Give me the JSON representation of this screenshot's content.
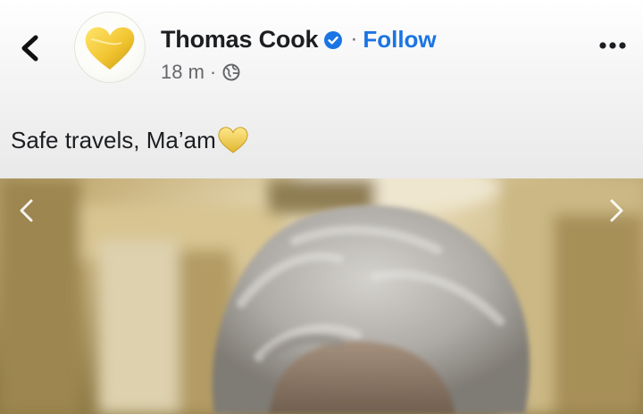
{
  "post": {
    "author": {
      "name": "Thomas Cook",
      "verified": true,
      "avatar_icon": "golden-heart-logo"
    },
    "follow_label": "Follow",
    "separator": "·",
    "timestamp": "18 m",
    "audience_icon": "globe-icon",
    "caption": "Safe travels, Ma’am",
    "caption_emoji": "yellow-heart-icon",
    "colors": {
      "follow": "#1b74e4",
      "verified_badge": "#1b74e4",
      "heart_gold": "#e8c340",
      "name_text": "#1c1e21",
      "meta_text": "#65676b"
    }
  },
  "controls": {
    "back_icon": "chevron-left-icon",
    "more_icon": "more-dots-icon",
    "carousel_prev_icon": "chevron-left-icon",
    "carousel_next_icon": "chevron-right-icon"
  }
}
